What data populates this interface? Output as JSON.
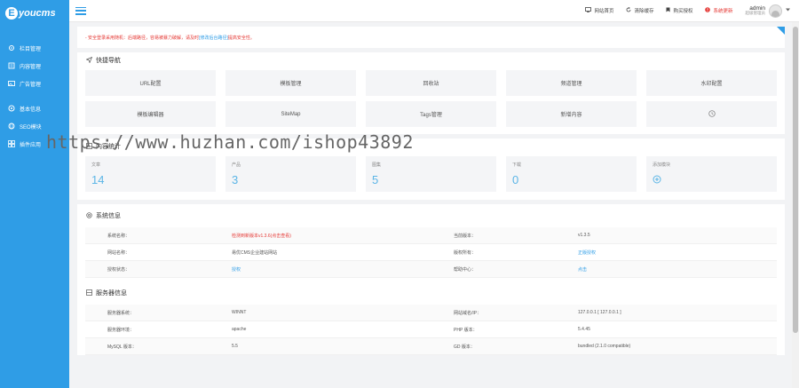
{
  "sidebar": {
    "logo_letter": "E",
    "logo_text": "youcms",
    "items": [
      {
        "label": "栏目管理",
        "icon": "gear-icon"
      },
      {
        "label": "内容管理",
        "icon": "document-icon"
      },
      {
        "label": "广告管理",
        "icon": "image-icon"
      },
      {
        "label": "基本信息",
        "icon": "settings-icon"
      },
      {
        "label": "SEO模块",
        "icon": "globe-icon"
      },
      {
        "label": "插件应用",
        "icon": "grid-icon"
      }
    ]
  },
  "topbar": {
    "actions": [
      {
        "label": "网站首页",
        "icon": "monitor-icon"
      },
      {
        "label": "清除缓存",
        "icon": "refresh-icon"
      },
      {
        "label": "购买授权",
        "icon": "bookmark-icon"
      },
      {
        "label": "系统更新",
        "icon": "alert-icon"
      }
    ],
    "user_name": "admin",
    "user_role": "超级管理员"
  },
  "notice": {
    "text": "- 安全登录采用随机：后端路径，容易被暴力破解，请及时",
    "link": "[修改后台路径]",
    "suffix": "提高安全性。"
  },
  "quick_nav": {
    "title": "快捷导航",
    "items": [
      "URL配置",
      "模板管理",
      "回收站",
      "频道管理",
      "水印配置",
      "模板编辑器",
      "SiteMap",
      "Tags管理",
      "新增内容",
      ""
    ]
  },
  "stats": {
    "title": "内容统计",
    "items": [
      {
        "label": "文章",
        "value": "14"
      },
      {
        "label": "产品",
        "value": "3"
      },
      {
        "label": "图集",
        "value": "5"
      },
      {
        "label": "下载",
        "value": "0"
      },
      {
        "label": "添加模块",
        "value": ""
      }
    ]
  },
  "system_info": {
    "title": "系统信息",
    "rows": [
      {
        "k1": "系统名称：",
        "v1": "检测到新版本v1.3.6(点击查看)",
        "k2": "当前版本：",
        "v2": "v1.3.5"
      },
      {
        "k1": "网站名称：",
        "v1": "易优CMS企业建站网站",
        "k2": "版权所有：",
        "v2": "正版授权"
      },
      {
        "k1": "授权状态：",
        "v1": "授权",
        "k2": "帮助中心：",
        "v2": "点击"
      }
    ]
  },
  "server_info": {
    "title": "服务器信息",
    "rows": [
      {
        "k1": "服务器系统：",
        "v1": "WINNT",
        "k2": "网站域名/IP：",
        "v2": "127.0.0.1 [ 127.0.0.1 ]"
      },
      {
        "k1": "服务器环境：",
        "v1": "apache",
        "k2": "PHP 版本：",
        "v2": "5.4.45"
      },
      {
        "k1": "MySQL 版本：",
        "v1": "5.5",
        "k2": "GD 版本：",
        "v2": "bundled (2.1.0 compatible)"
      }
    ]
  },
  "watermark": "https://www.huzhan.com/ishop43892",
  "colors": {
    "accent": "#2f9de6",
    "warning": "#e53935",
    "stat_value": "#5bb5e6"
  }
}
